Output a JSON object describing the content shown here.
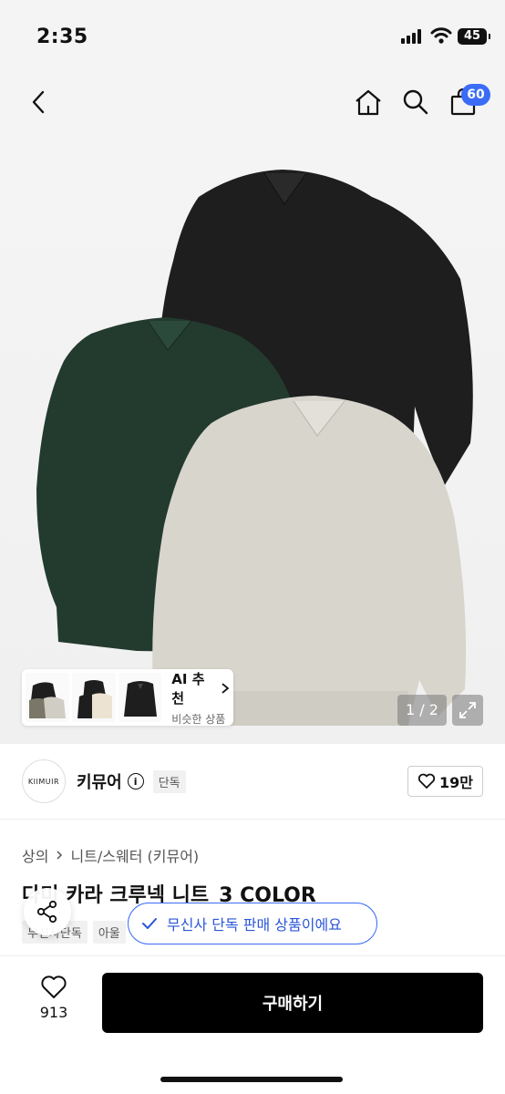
{
  "status_bar": {
    "time": "2:35",
    "battery": "45"
  },
  "nav": {
    "cart_count": "60"
  },
  "icons": {
    "back": "chevron-left-icon",
    "home": "home-icon",
    "search": "search-icon",
    "cart": "shopping-bag-icon",
    "info": "info-icon",
    "heart": "heart-icon",
    "share": "share-icon",
    "check": "check-icon",
    "expand": "expand-icon"
  },
  "gallery": {
    "pager": "1 / 2",
    "colors": [
      "#1e1e1e",
      "#233a2f",
      "#d8d5cd"
    ],
    "ai_card": {
      "title": "AI 추천",
      "subtitle": "비슷한 상품"
    }
  },
  "brand": {
    "logo_text": "KIIMUIR",
    "name": "키뮤어",
    "badge": "단독",
    "like_count": "19만"
  },
  "breadcrumb": {
    "category": "상의",
    "subcategory": "니트/스웨터 (키뮤어)"
  },
  "product": {
    "title": "다미 카라 크루넥 니트_3 COLOR",
    "tags": [
      "무신사단독",
      "아울"
    ]
  },
  "toast": {
    "message": "무신사 단독 판매 상품이에요"
  },
  "bottom_bar": {
    "wish_count": "913",
    "buy_label": "구매하기"
  },
  "accent_color": "#3a6cf6"
}
